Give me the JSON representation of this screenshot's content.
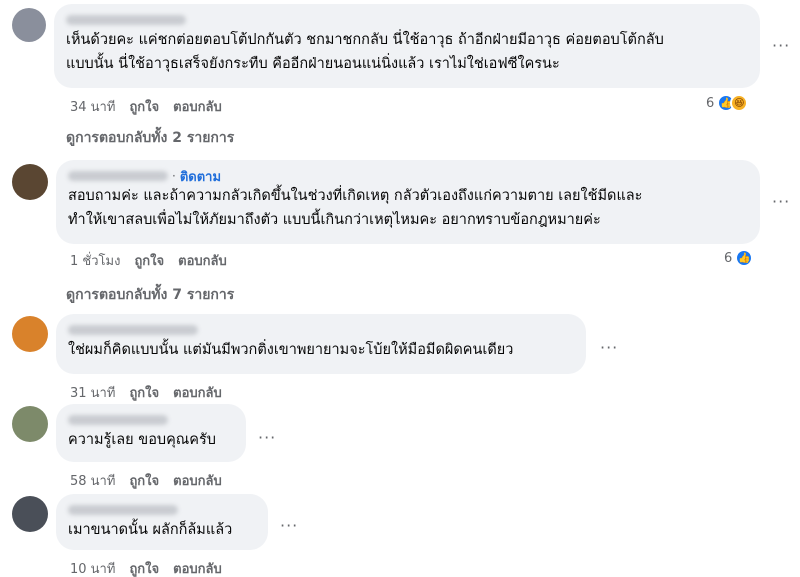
{
  "comments": [
    {
      "text_lines": [
        "เห็นด้วยคะ แค่ชกต่อยตอบโต้ปกกันตัว ชกมาชกกลับ นี่ใช้อาวุธ ถ้าอีกฝ่ายมีอาวุธ ค่อยตอบโต้กลับ",
        "แบบนั้น นี่ใช้อาวุธเสร็จยังกระทืบ คืออีกฝ่ายนอนแน่นิ่งแล้ว เราไม่ใช่เอฟซีใครนะ"
      ],
      "time": "34 นาที",
      "like_label": "ถูกใจ",
      "reply_label": "ตอบกลับ",
      "reaction_count": "6",
      "avatar_color": "#8a8f9c"
    },
    {
      "follow_label": "ติดตาม",
      "text_lines": [
        "สอบถามค่ะ และถ้าความกลัวเกิดขึ้นในช่วงที่เกิดเหตุ กลัวตัวเองถึงแก่ความตาย เลยใช้มีดและ",
        "ทำให้เขาสลบเพื่อไม่ให้ภัยมาถึงตัว แบบนี้เกินกว่าเหตุไหมคะ อยากทราบข้อกฎหมายค่ะ"
      ],
      "time": "1 ชั่วโมง",
      "like_label": "ถูกใจ",
      "reply_label": "ตอบกลับ",
      "reaction_count": "6",
      "avatar_color": "#5a4632"
    },
    {
      "text_lines": [
        "ใช่ผมก็คิดแบบนั้น แต่มันมีพวกติ่งเขาพยายามจะโบ้ยให้มือมีดผิดคนเดียว"
      ],
      "time": "31 นาที",
      "like_label": "ถูกใจ",
      "reply_label": "ตอบกลับ",
      "avatar_color": "#d9822b"
    },
    {
      "text_lines": [
        "ความรู้เลย ขอบคุณครับ"
      ],
      "time": "58 นาที",
      "like_label": "ถูกใจ",
      "reply_label": "ตอบกลับ",
      "avatar_color": "#7d8a6a"
    },
    {
      "text_lines": [
        "เมาขนาดนั้น ผลักก็ล้มแล้ว"
      ],
      "time": "10 นาที",
      "like_label": "ถูกใจ",
      "reply_label": "ตอบกลับ",
      "avatar_color": "#4a4f58"
    }
  ],
  "view_replies": [
    "ดูการตอบกลับทั้ง 2 รายการ",
    "ดูการตอบกลับทั้ง 7 รายการ"
  ],
  "more_options": "···",
  "icons": {
    "like": "like-icon",
    "haha": "haha-icon"
  },
  "colors": {
    "bubble": "#f0f2f5",
    "link": "#216fdb",
    "like": "#1877f2",
    "meta": "#65676b"
  }
}
